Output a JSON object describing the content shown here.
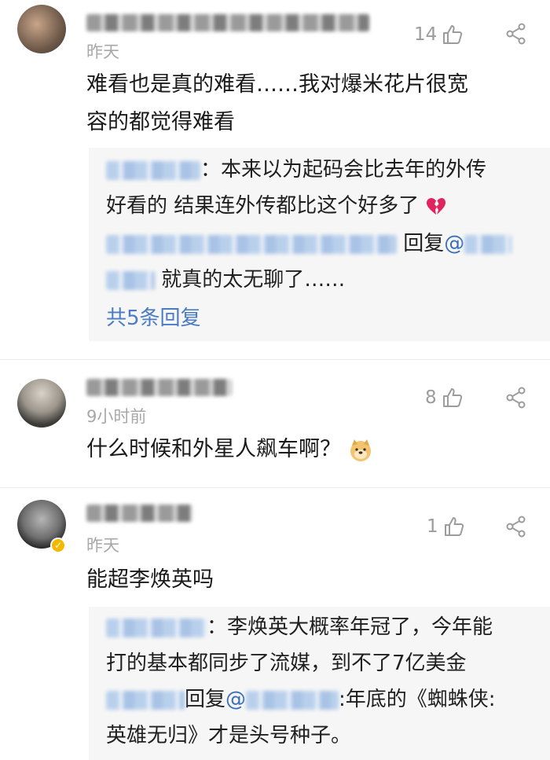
{
  "comments": [
    {
      "time": "昨天",
      "likes": "14",
      "body_line1": "难看也是真的难看……我对爆米花片很宽",
      "body_line2": "容的都觉得难看",
      "replies": {
        "r1_text_line1": "：本来以为起码会比去年的外传",
        "r1_text_line2": "好看的 结果连外传都比这个好多了",
        "r2_reply_word": " 回复",
        "r2_at": "@",
        "r2_text": " 就真的太无聊了……",
        "more": "共5条回复"
      }
    },
    {
      "time": "9小时前",
      "likes": "8",
      "body_line1": "什么时候和外星人飙车啊？"
    },
    {
      "time": "昨天",
      "likes": "1",
      "body_line1": "能超李焕英吗",
      "replies": {
        "r1_text_line1": "：李焕英大概率年冠了，今年能",
        "r1_text_line2": "打的基本都同步了流媒，到不了7亿美金",
        "r2_reply_word": "回复",
        "r2_at": "@",
        "r2_text_line1": ":年底的《蜘蛛侠:",
        "r2_text_line2": "英雄无归》才是头号种子。"
      }
    }
  ],
  "icons": {
    "like": "thumbs-up-icon",
    "share": "share-icon",
    "broken_heart": "broken-heart-emoji",
    "doge": "doge-emoji",
    "verified": "verified-badge-icon"
  },
  "colors": {
    "link_blue": "#4a7cc4",
    "time_gray": "#a8a8a8",
    "reply_bg": "#f6f6f6",
    "badge_gold": "#f5b800"
  }
}
